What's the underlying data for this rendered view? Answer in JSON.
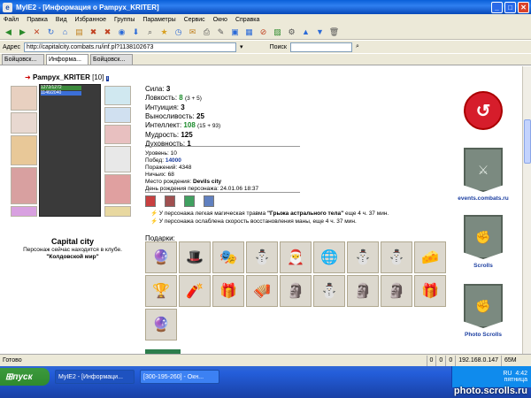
{
  "window": {
    "title": "MyIE2 - [Информация о Pampyx_KRITER]"
  },
  "menu": [
    "Файл",
    "Правка",
    "Вид",
    "Избранное",
    "Группы",
    "Параметры",
    "Сервис",
    "Окно",
    "Справка"
  ],
  "address": {
    "label": "Адрес",
    "url": "http://capitalcity.combats.ru/inf.pl?1138102673",
    "search_label": "Поиск"
  },
  "tabs": [
    "Бойцовск...",
    "Информа...",
    "Бойцовск..."
  ],
  "character": {
    "nick": "Pampyx_KRITER",
    "level": "[10]",
    "hp": "1272/1272",
    "mp": "1146/2040",
    "city": "Capital city",
    "club_line": "Персонаж сейчас находится в клубе.",
    "club_name": "\"Колдовской мир\""
  },
  "stats": [
    {
      "label": "Сила:",
      "value": "3",
      "extra": ""
    },
    {
      "label": "Ловкость:",
      "value": "8",
      "extra": "(3 + 5)"
    },
    {
      "label": "Интуиция:",
      "value": "3",
      "extra": ""
    },
    {
      "label": "Выносливость:",
      "value": "25",
      "extra": ""
    },
    {
      "label": "Интеллект:",
      "value": "108",
      "extra": "(15 + 93)"
    },
    {
      "label": "Мудрость:",
      "value": "125",
      "extra": ""
    },
    {
      "label": "Духовность:",
      "value": "1",
      "extra": ""
    }
  ],
  "info": {
    "level": "Уровень: 10",
    "wins_label": "Побед:",
    "wins": "14000",
    "losses": "Поражений: 4348",
    "draws": "Ничьих: 68",
    "birthplace_label": "Место рождения:",
    "birthplace": "Devils city",
    "birthday": "День рождения персонажа: 24.01.06 18:37"
  },
  "notes": [
    {
      "pre": "У персонажа легкая магическая травма ",
      "bold": "\"Грыжа астрального тела\"",
      "post": " еще 4 ч. 37 мин."
    },
    {
      "pre": "У персонажа ослаблена скорость восстановления маны, еще 4 ч. 37 мин.",
      "bold": "",
      "post": ""
    }
  ],
  "gifts_title": "Подарки:",
  "gifts": [
    "🔮",
    "🎩",
    "🎭",
    "⛄",
    "🎅",
    "🌐",
    "⛄",
    "⛄",
    "🧀",
    "🏆",
    "🧨",
    "🎁",
    "🪗",
    "🗿",
    "⛄",
    "🗿",
    "🗿",
    "🎁",
    "🔮",
    "🏆"
  ],
  "sidebar": {
    "events": "events.combats.ru",
    "scrolls": "Scrolls",
    "photo": "Photo Scrolls"
  },
  "status": {
    "text": "Готово",
    "zero1": "0",
    "zero2": "0",
    "zero3": "0",
    "ip": "192.168.0.147",
    "mem": "65M"
  },
  "taskbar": {
    "start": "пуск",
    "tasks": [
      "MyIE2 - [Информаци...",
      "[300-195-260] - Окн..."
    ],
    "lang": "RU",
    "time": "4:42",
    "day": "пятница"
  },
  "watermark": "photo.scrolls.ru",
  "colors": {
    "accent": "#1941a5",
    "wins": "#1a3da0",
    "int": "#1a8a2a"
  }
}
